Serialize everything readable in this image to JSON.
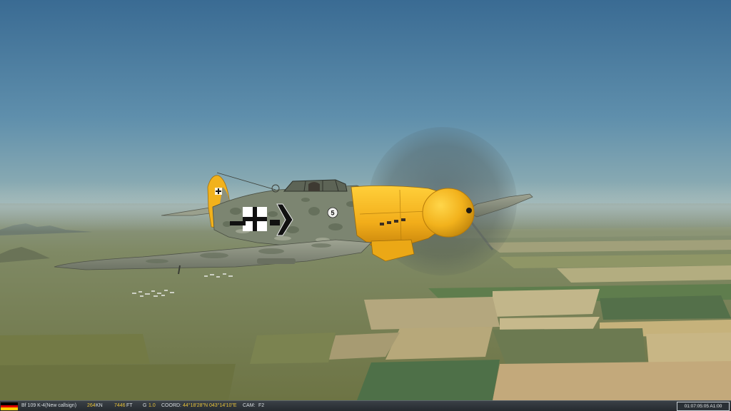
{
  "hud": {
    "aircraft": "Bf 109 K-4(New callsign)",
    "speed_value": "264",
    "speed_unit": "KN",
    "altitude_value": "7446",
    "altitude_unit": "FT",
    "g_label": "G",
    "g_value": "1.0",
    "coord_label": "COORD:",
    "coord_value": "44°18'28\"N 043°14'10\"E",
    "cam_label": "CAM:",
    "cam_value": "F2",
    "time": "01:07:05:05 A1:00",
    "flag_colors": [
      "#000000",
      "#dd0000",
      "#ffce00"
    ],
    "value_color": "#e8c23a"
  },
  "aircraft_markings": {
    "fuselage_number": "5",
    "cross_icon": "balkenkreuz-icon",
    "chevron_icon": "chevron-icon",
    "tail_icon": "swastika-icon",
    "nose_color": "#f2b21c",
    "camo_color": "#7c8571"
  }
}
